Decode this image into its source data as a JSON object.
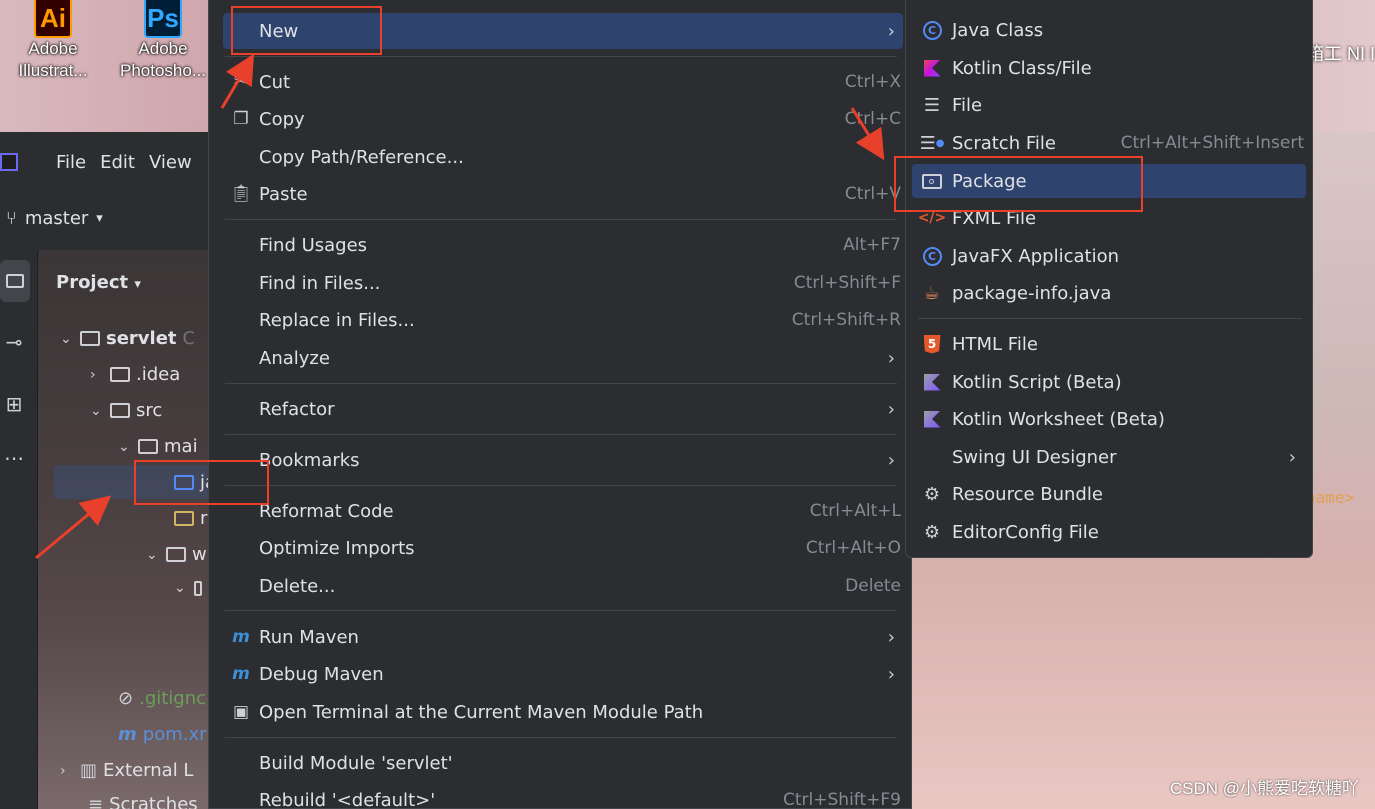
{
  "desktop": {
    "icons": [
      {
        "badge": "Ai",
        "label_line1": "Adobe",
        "label_line2": "Illustrat..."
      },
      {
        "badge": "Ps",
        "label_line1": "Adobe",
        "label_line2": "Photosho..."
      }
    ],
    "right_fragment": "箱工 NI I"
  },
  "ide": {
    "menubar": [
      "File",
      "Edit",
      "View"
    ],
    "branch": "master",
    "project_title": "Project",
    "tree": [
      {
        "label": "servlet",
        "suffix": "C"
      },
      {
        "label": ".idea"
      },
      {
        "label": "src"
      },
      {
        "label": "mai"
      },
      {
        "label": "ja"
      },
      {
        "label": "r"
      },
      {
        "label": "w"
      },
      {
        "label": ""
      },
      {
        "label": ".gitignc"
      },
      {
        "label": "pom.xr"
      },
      {
        "label": "External L"
      },
      {
        "label": "Scratches"
      }
    ],
    "editor_fragment": "name>"
  },
  "context_menu": {
    "items": [
      {
        "label": "New",
        "shortcut": "",
        "submenu": true,
        "icon": ""
      },
      {
        "label": "Cut",
        "shortcut": "Ctrl+X",
        "icon": "scissors-icon"
      },
      {
        "label": "Copy",
        "shortcut": "Ctrl+C",
        "icon": "copy-icon"
      },
      {
        "label": "Copy Path/Reference...",
        "shortcut": "",
        "icon": ""
      },
      {
        "label": "Paste",
        "shortcut": "Ctrl+V",
        "icon": "paste-icon"
      },
      {
        "label": "Find Usages",
        "shortcut": "Alt+F7",
        "icon": ""
      },
      {
        "label": "Find in Files...",
        "shortcut": "Ctrl+Shift+F",
        "icon": ""
      },
      {
        "label": "Replace in Files...",
        "shortcut": "Ctrl+Shift+R",
        "icon": ""
      },
      {
        "label": "Analyze",
        "shortcut": "",
        "submenu": true,
        "icon": ""
      },
      {
        "label": "Refactor",
        "shortcut": "",
        "submenu": true,
        "icon": ""
      },
      {
        "label": "Bookmarks",
        "shortcut": "",
        "submenu": true,
        "icon": ""
      },
      {
        "label": "Reformat Code",
        "shortcut": "Ctrl+Alt+L",
        "icon": ""
      },
      {
        "label": "Optimize Imports",
        "shortcut": "Ctrl+Alt+O",
        "icon": ""
      },
      {
        "label": "Delete...",
        "shortcut": "Delete",
        "icon": ""
      },
      {
        "label": "Run Maven",
        "shortcut": "",
        "submenu": true,
        "icon": "maven-icon"
      },
      {
        "label": "Debug Maven",
        "shortcut": "",
        "submenu": true,
        "icon": "maven-debug-icon"
      },
      {
        "label": "Open Terminal at the Current Maven Module Path",
        "shortcut": "",
        "icon": "terminal-icon"
      },
      {
        "label": "Build Module 'servlet'",
        "shortcut": "",
        "icon": ""
      },
      {
        "label": "Rebuild '<default>'",
        "shortcut": "Ctrl+Shift+F9",
        "icon": ""
      }
    ]
  },
  "new_submenu": {
    "items": [
      {
        "label": "Java Class",
        "shortcut": "",
        "icon": "java-class-icon"
      },
      {
        "label": "Kotlin Class/File",
        "shortcut": "",
        "icon": "kotlin-icon"
      },
      {
        "label": "File",
        "shortcut": "",
        "icon": "file-icon"
      },
      {
        "label": "Scratch File",
        "shortcut": "Ctrl+Alt+Shift+Insert",
        "icon": "scratch-file-icon"
      },
      {
        "label": "Package",
        "shortcut": "",
        "icon": "package-icon"
      },
      {
        "label": "FXML File",
        "shortcut": "",
        "icon": "fxml-icon"
      },
      {
        "label": "JavaFX Application",
        "shortcut": "",
        "icon": "javafx-icon"
      },
      {
        "label": "package-info.java",
        "shortcut": "",
        "icon": "package-info-icon"
      },
      {
        "label": "HTML File",
        "shortcut": "",
        "icon": "html-icon"
      },
      {
        "label": "Kotlin Script (Beta)",
        "shortcut": "",
        "icon": "kotlin-script-icon"
      },
      {
        "label": "Kotlin Worksheet (Beta)",
        "shortcut": "",
        "icon": "kotlin-worksheet-icon"
      },
      {
        "label": "Swing UI Designer",
        "shortcut": "",
        "submenu": true,
        "icon": ""
      },
      {
        "label": "Resource Bundle",
        "shortcut": "",
        "icon": "gear-icon"
      },
      {
        "label": "EditorConfig File",
        "shortcut": "",
        "icon": "gear-icon"
      }
    ]
  },
  "watermark": "CSDN @小熊爱吃软糖吖",
  "colors": {
    "highlight": "#2e436e",
    "annotation_red": "#e8402a",
    "menu_bg": "#2b2d30"
  }
}
